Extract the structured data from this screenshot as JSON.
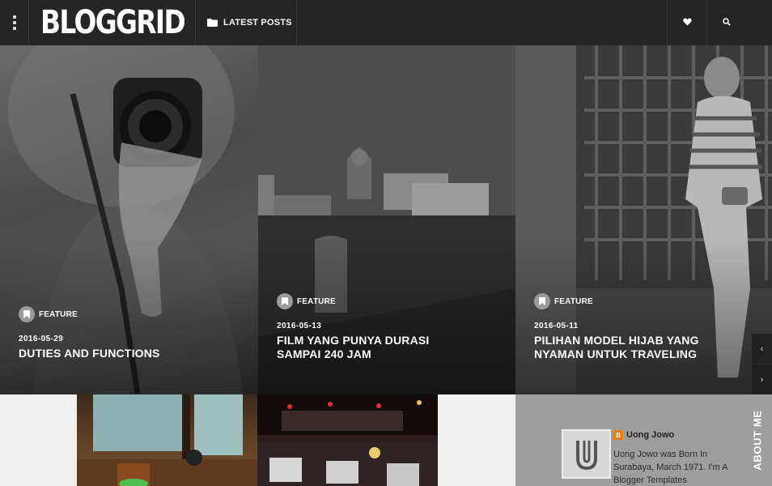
{
  "header": {
    "logo": "BLOGGRID",
    "nav_label": "LATEST POSTS"
  },
  "featured_posts": [
    {
      "badge": "FEATURE",
      "date": "2016-05-29",
      "title": "DUTIES AND FUNCTIONS"
    },
    {
      "badge": "FEATURE",
      "date": "2016-05-13",
      "title": "FILM YANG PUNYA DURASI SAMPAI 240 JAM"
    },
    {
      "badge": "FEATURE",
      "date": "2016-05-11",
      "title": "PILIHAN MODEL HIJAB YANG NYAMAN UNTUK TRAVELING"
    }
  ],
  "slider": {
    "prev_icon": "chevron-left-icon",
    "next_icon": "chevron-right-icon"
  },
  "about": {
    "label": "ABOUT ME",
    "author_name": "Uong Jowo",
    "bio": "Uong Jowo was Born In Surabaya, March 1971. I'm A Blogger Templates"
  },
  "colors": {
    "topbar": "#252525",
    "about_bg": "#9e9e9e",
    "blogger_orange": "#f57d00"
  }
}
